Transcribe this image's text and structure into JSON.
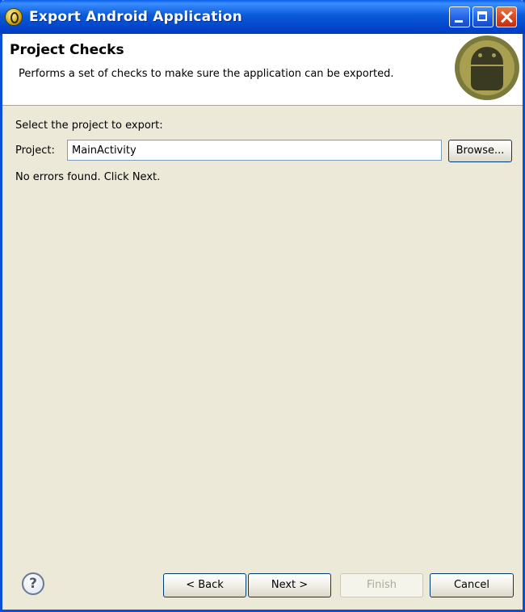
{
  "window": {
    "title": "Export Android Application",
    "controls": [
      "minimize",
      "maximize",
      "close"
    ]
  },
  "header": {
    "title": "Project Checks",
    "description": "Performs a set of checks to make sure the application can be exported."
  },
  "form": {
    "select_label": "Select the project to export:",
    "project_label": "Project:",
    "project_value": "MainActivity",
    "browse_label": "Browse...",
    "status_message": "No errors found. Click Next."
  },
  "footer": {
    "help_icon": "?",
    "back_label": "< Back",
    "next_label": "Next >",
    "finish_label": "Finish",
    "finish_enabled": false,
    "cancel_label": "Cancel"
  },
  "colors": {
    "titlebar": "#0a5ad8",
    "dialog_background": "#ece9d8",
    "header_background": "#ffffff"
  }
}
